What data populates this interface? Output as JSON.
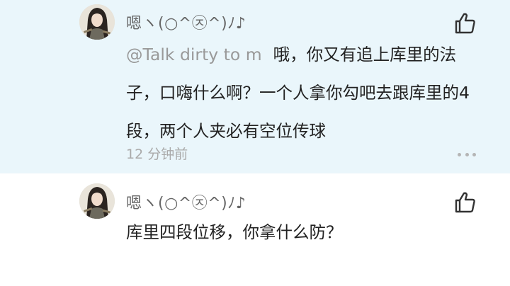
{
  "comments": [
    {
      "username": "嗯ヽ(○^㉨^)ﾉ♪",
      "mention": "@Talk dirty to m",
      "text": "哦，你又有追上库里的法子，口嗨什么啊？一个人拿你勾吧去跟库里的4段，两个人夹必有空位传球",
      "timestamp": "12 分钟前",
      "highlighted": true
    },
    {
      "username": "嗯ヽ(○^㉨^)ﾉ♪",
      "text": "库里四段位移，你拿什么防？",
      "highlighted": false
    }
  ],
  "icons": {
    "like": "thumbs-up-icon",
    "more": "more-options-icon",
    "avatar": "anime-avatar"
  },
  "colors": {
    "highlight_bg": "#eaf6fb",
    "text": "#222222",
    "muted": "#999999"
  }
}
